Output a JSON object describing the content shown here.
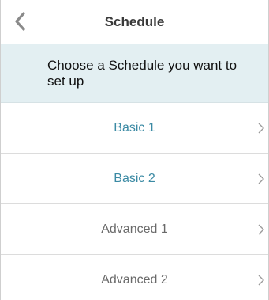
{
  "header": {
    "title": "Schedule",
    "back_icon": "chevron-left-icon"
  },
  "prompt": {
    "text": "Choose a Schedule you want to set up"
  },
  "schedules": [
    {
      "label": "Basic 1",
      "color": "#3b8aa4"
    },
    {
      "label": "Basic 2",
      "color": "#3b8aa4"
    },
    {
      "label": "Advanced 1",
      "color": "#6a6a6a"
    },
    {
      "label": "Advanced 2",
      "color": "#6a6a6a"
    }
  ],
  "colors": {
    "basic_text": "#3b8aa4",
    "advanced_text": "#6a6a6a",
    "prompt_background": "#e3eff2",
    "chevron": "#9a9a9a",
    "back_icon": "#8a8a8a"
  }
}
